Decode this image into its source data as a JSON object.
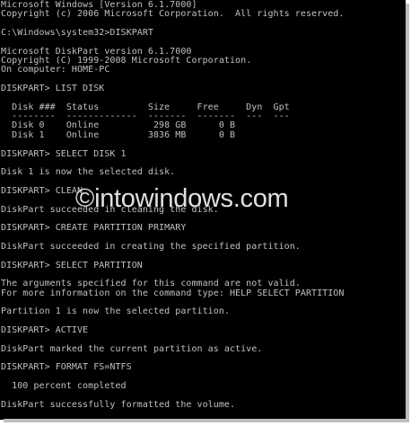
{
  "console": {
    "lines": [
      "Microsoft Windows [Version 6.1.7000]",
      "Copyright (c) 2006 Microsoft Corporation.  All rights reserved.",
      "",
      "C:\\Windows\\system32>DISKPART",
      "",
      "Microsoft DiskPart version 6.1.7000",
      "Copyright (C) 1999-2008 Microsoft Corporation.",
      "On computer: HOME-PC",
      "",
      "DISKPART> LIST DISK",
      "",
      "  Disk ###  Status         Size     Free     Dyn  Gpt",
      "  --------  -------------  -------  -------  ---  ---",
      "  Disk 0    Online          298 GB      0 B",
      "  Disk 1    Online         3836 MB      0 B",
      "",
      "DISKPART> SELECT DISK 1",
      "",
      "Disk 1 is now the selected disk.",
      "",
      "DISKPART> CLEAN",
      "",
      "DiskPart succeeded in cleaning the disk.",
      "",
      "DISKPART> CREATE PARTITION PRIMARY",
      "",
      "DiskPart succeeded in creating the specified partition.",
      "",
      "DISKPART> SELECT PARTITION",
      "",
      "The arguments specified for this command are not valid.",
      "For more information on the command type: HELP SELECT PARTITION",
      "",
      "Partition 1 is now the selected partition.",
      "",
      "DISKPART> ACTIVE",
      "",
      "DiskPart marked the current partition as active.",
      "",
      "DISKPART> FORMAT FS=NTFS",
      "",
      "  100 percent completed",
      "",
      "DiskPart successfully formatted the volume.",
      ""
    ]
  },
  "watermark": "©intowindows.com",
  "colors": {
    "background": "#000000",
    "text": "#c0c0c0",
    "shadow": "#bdbdbd"
  }
}
